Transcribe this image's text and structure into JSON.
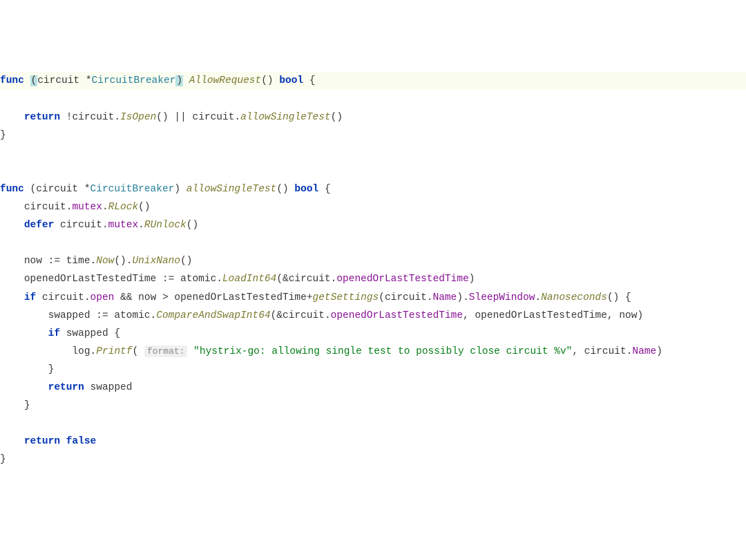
{
  "code": {
    "line1": {
      "func": "func",
      "lparen": "(",
      "receiver": "circuit",
      "star": "*",
      "type": "CircuitBreaker",
      "rparen": ")",
      "name": "AllowRequest",
      "parens": "()",
      "ret": "bool",
      "lbrace": "{"
    },
    "line2": {
      "return": "return",
      "neg": "!",
      "recv": "circuit",
      "dot1": ".",
      "m1": "IsOpen",
      "p1": "()",
      "or": "||",
      "recv2": "circuit",
      "dot2": ".",
      "m2": "allowSingleTest",
      "p2": "()"
    },
    "line3": {
      "rbrace": "}"
    },
    "line5": {
      "func": "func",
      "lparen": "(",
      "receiver": "circuit",
      "star": "*",
      "type": "CircuitBreaker",
      "rparen": ")",
      "name": "allowSingleTest",
      "parens": "()",
      "ret": "bool",
      "lbrace": "{"
    },
    "line6": {
      "recv": "circuit",
      "d1": ".",
      "f": "mutex",
      "d2": ".",
      "m": "RLock",
      "p": "()"
    },
    "line7": {
      "defer": "defer",
      "recv": "circuit",
      "d1": ".",
      "f": "mutex",
      "d2": ".",
      "m": "RUnlock",
      "p": "()"
    },
    "line9": {
      "v": "now",
      "assign": ":=",
      "pkg": "time",
      "d1": ".",
      "m1": "Now",
      "p1": "()",
      "d2": ".",
      "m2": "UnixNano",
      "p2": "()"
    },
    "line10": {
      "v": "openedOrLastTestedTime",
      "assign": ":=",
      "pkg": "atomic",
      "d1": ".",
      "m": "LoadInt64",
      "lp": "(",
      "amp": "&",
      "recv": "circuit",
      "d2": ".",
      "f": "openedOrLastTestedTime",
      "rp": ")"
    },
    "line11": {
      "if": "if",
      "recv": "circuit",
      "d1": ".",
      "f1": "open",
      "and": "&&",
      "v1": "now",
      "gt": ">",
      "v2": "openedOrLastTestedTime",
      "plus": "+",
      "fn": "getSettings",
      "lp": "(",
      "recv2": "circuit",
      "d2": ".",
      "f2": "Name",
      "rp": ")",
      "d3": ".",
      "f3": "SleepWindow",
      "d4": ".",
      "m": "Nanoseconds",
      "p": "()",
      "lbrace": "{"
    },
    "line12": {
      "v": "swapped",
      "assign": ":=",
      "pkg": "atomic",
      "d1": ".",
      "m": "CompareAndSwapInt64",
      "lp": "(",
      "amp": "&",
      "recv": "circuit",
      "d2": ".",
      "f1": "openedOrLastTestedTime",
      "c1": ",",
      "a2": "openedOrLastTestedTime",
      "c2": ",",
      "a3": "now",
      "rp": ")"
    },
    "line13": {
      "if": "if",
      "v": "swapped",
      "lbrace": "{"
    },
    "line14": {
      "pkg": "log",
      "d1": ".",
      "m": "Printf",
      "lp": "(",
      "hint": "format:",
      "str": "\"hystrix-go: allowing single test to possibly close circuit %v\"",
      "c": ",",
      "recv": "circuit",
      "d2": ".",
      "f": "Name",
      "rp": ")"
    },
    "line15": {
      "rbrace": "}"
    },
    "line16": {
      "return": "return",
      "v": "swapped"
    },
    "line17": {
      "rbrace": "}"
    },
    "line19": {
      "return": "return",
      "false": "false"
    },
    "line20": {
      "rbrace": "}"
    }
  }
}
